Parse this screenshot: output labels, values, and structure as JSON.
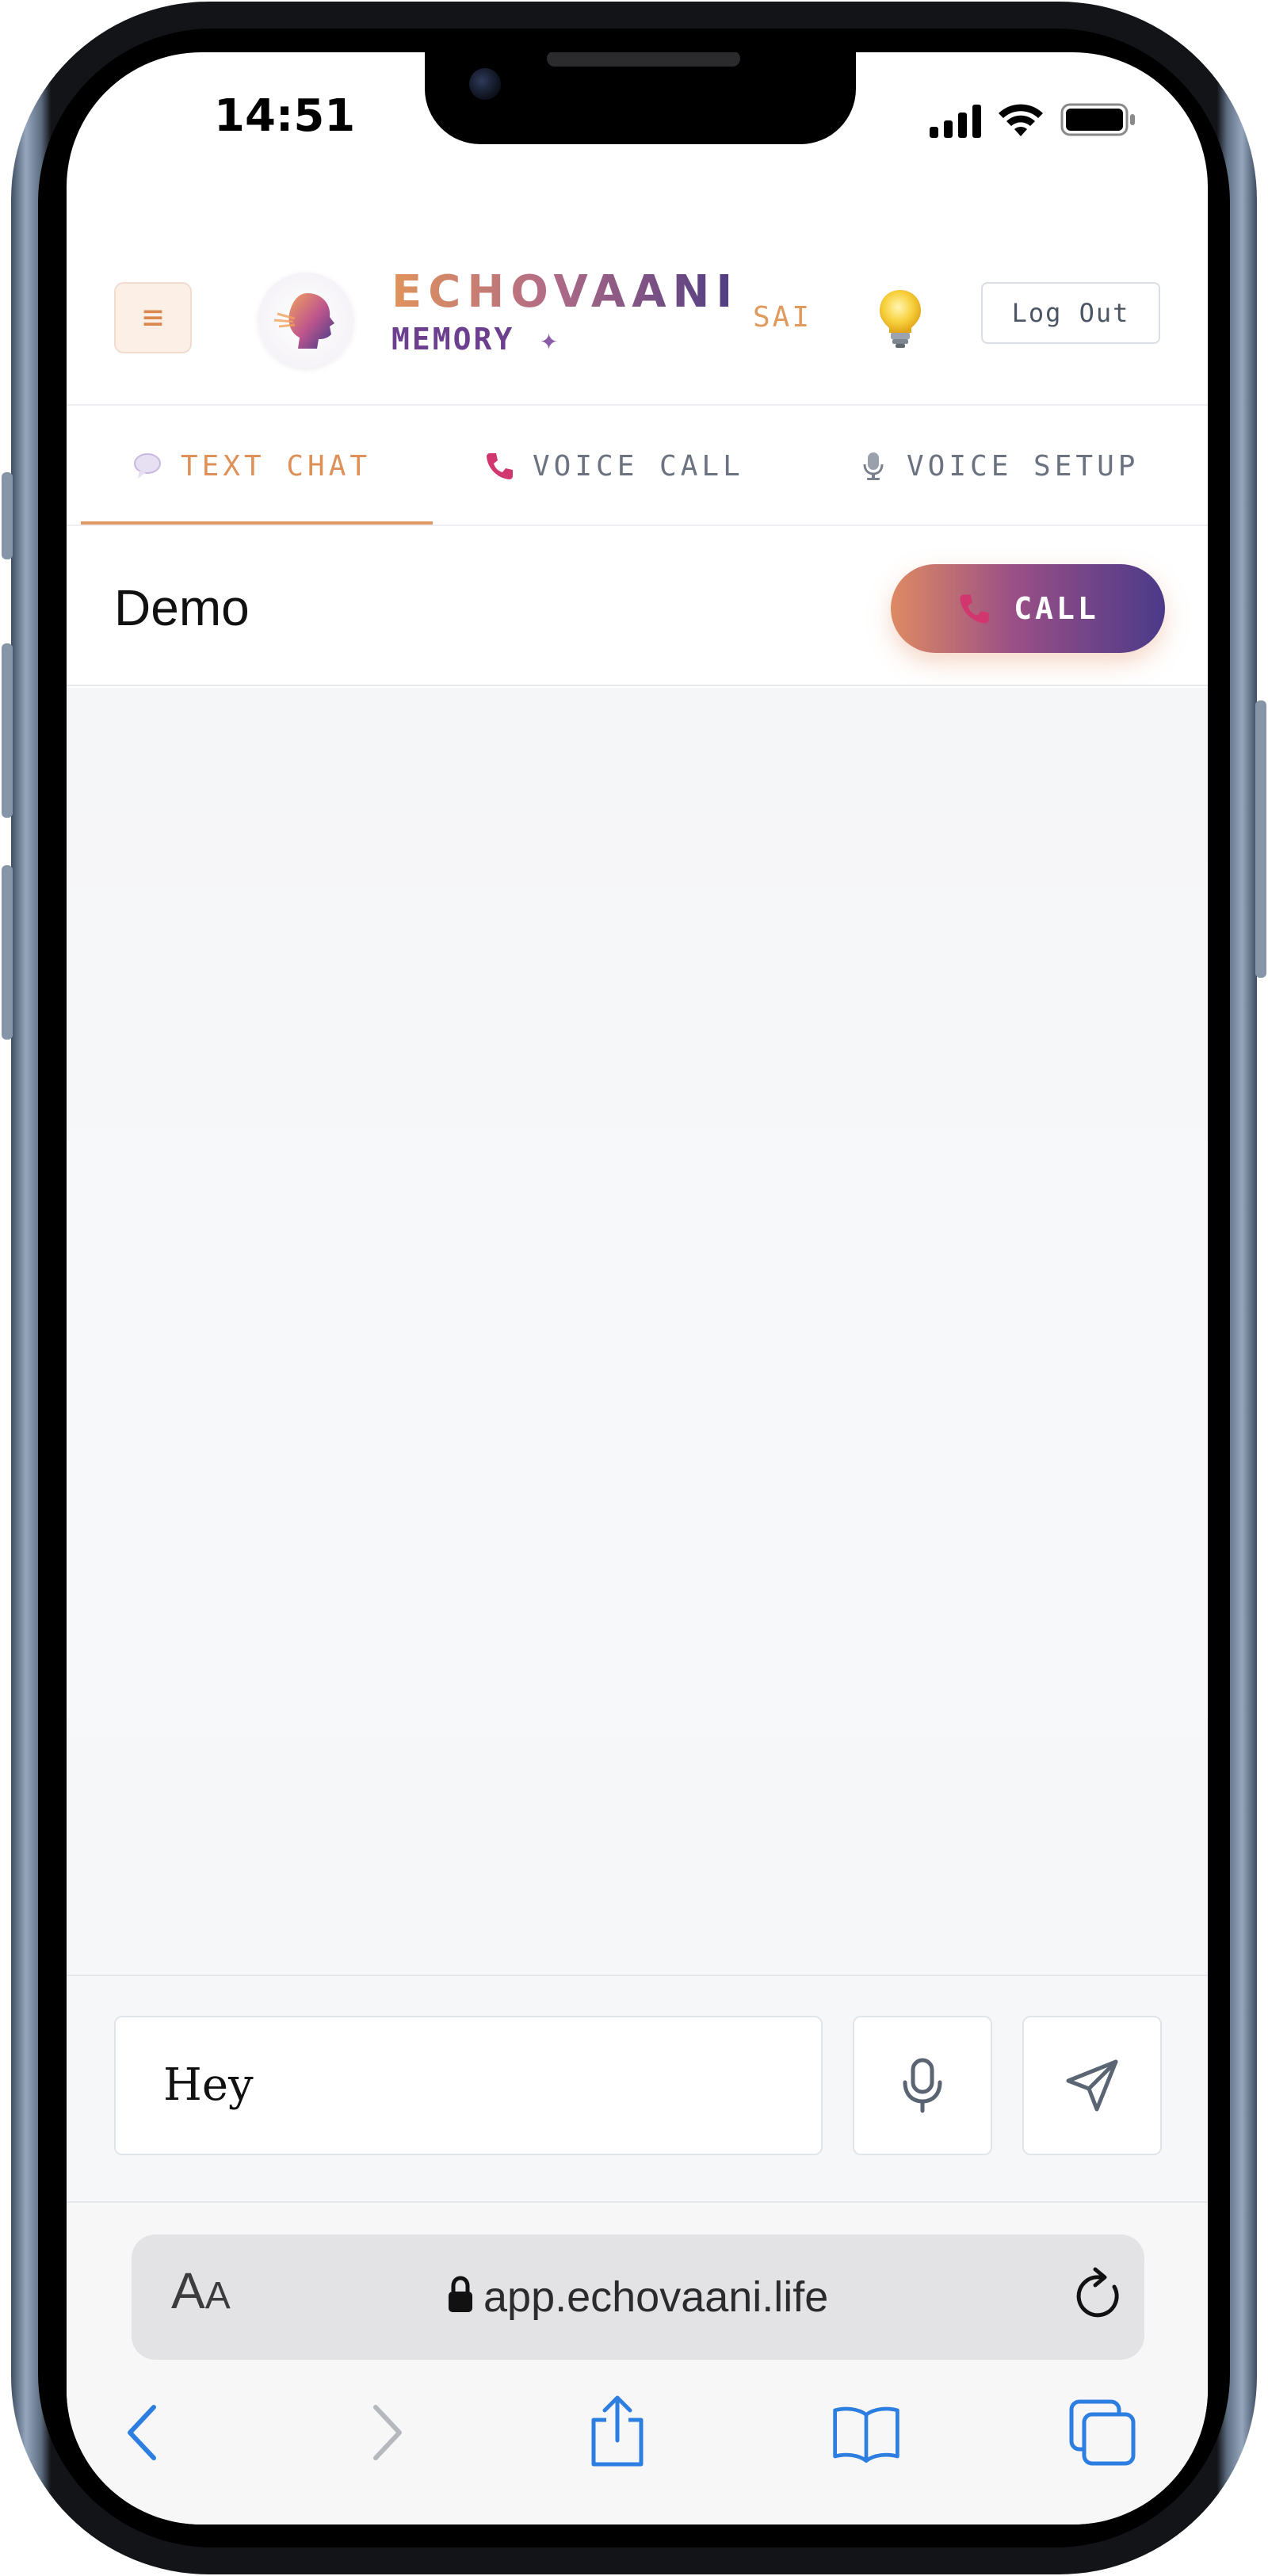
{
  "status_bar": {
    "time": "14:51"
  },
  "header": {
    "menu_glyph": "≡",
    "brand_name": "ECHOVAANI",
    "brand_sub": "MEMORY",
    "brand_sparkle": "✦",
    "user_name": "SAI",
    "logout_label": "Log Out"
  },
  "tabs": [
    {
      "label": "TEXT CHAT",
      "icon": "speech-bubble-icon",
      "active": true
    },
    {
      "label": "VOICE CALL",
      "icon": "phone-icon",
      "active": false
    },
    {
      "label": "VOICE SETUP",
      "icon": "microphone-icon",
      "active": false
    }
  ],
  "conversation": {
    "title": "Demo",
    "call_label": "CALL"
  },
  "composer": {
    "value": "Hey"
  },
  "browser": {
    "text_size_big": "A",
    "text_size_small": "A",
    "url": "app.echovaani.life"
  },
  "colors": {
    "accent_orange": "#dd9158",
    "accent_purple": "#4b3a89",
    "ios_blue": "#2c7ee0"
  }
}
